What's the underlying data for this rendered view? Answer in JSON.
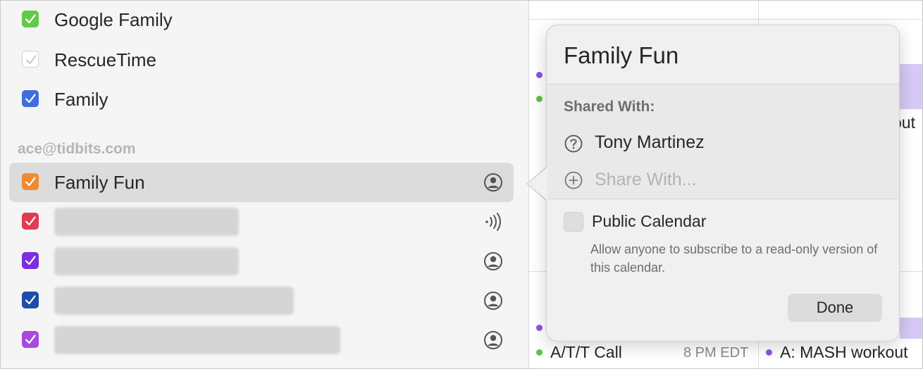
{
  "sidebar": {
    "items_top": [
      {
        "label": "Google Family",
        "color": "#63c94a",
        "checked": true
      },
      {
        "label": "RescueTime",
        "color": "#ffffff",
        "checked": true
      },
      {
        "label": "Family",
        "color": "#3f6fdc",
        "checked": true
      }
    ],
    "account_header": "ace@tidbits.com",
    "selected_calendar": {
      "label": "Family Fun",
      "color": "#f08a30",
      "icon": "shared-person-icon"
    },
    "redacted_items": [
      {
        "color": "#e23a52",
        "icon": "broadcast-icon"
      },
      {
        "color": "#7b2fe0",
        "icon": "shared-person-icon"
      },
      {
        "color": "#1f4ca8",
        "icon": "shared-person-icon"
      },
      {
        "color": "#a64bdc",
        "icon": "shared-person-icon"
      }
    ]
  },
  "calendar_bg": {
    "event_partial": "out",
    "event_bottom_left": "A/T/T Call",
    "event_bottom_left_time": "8 PM EDT",
    "event_bottom_right": "A: MASH workout",
    "dot_purple": "#8a55e8",
    "dot_green": "#5cc447"
  },
  "popover": {
    "title": "Family Fun",
    "shared_with_label": "Shared With:",
    "shared_person": "Tony Martinez",
    "share_placeholder": "Share With...",
    "public_label": "Public Calendar",
    "public_description": "Allow anyone to subscribe to a read-only version of this calendar.",
    "done_label": "Done"
  }
}
